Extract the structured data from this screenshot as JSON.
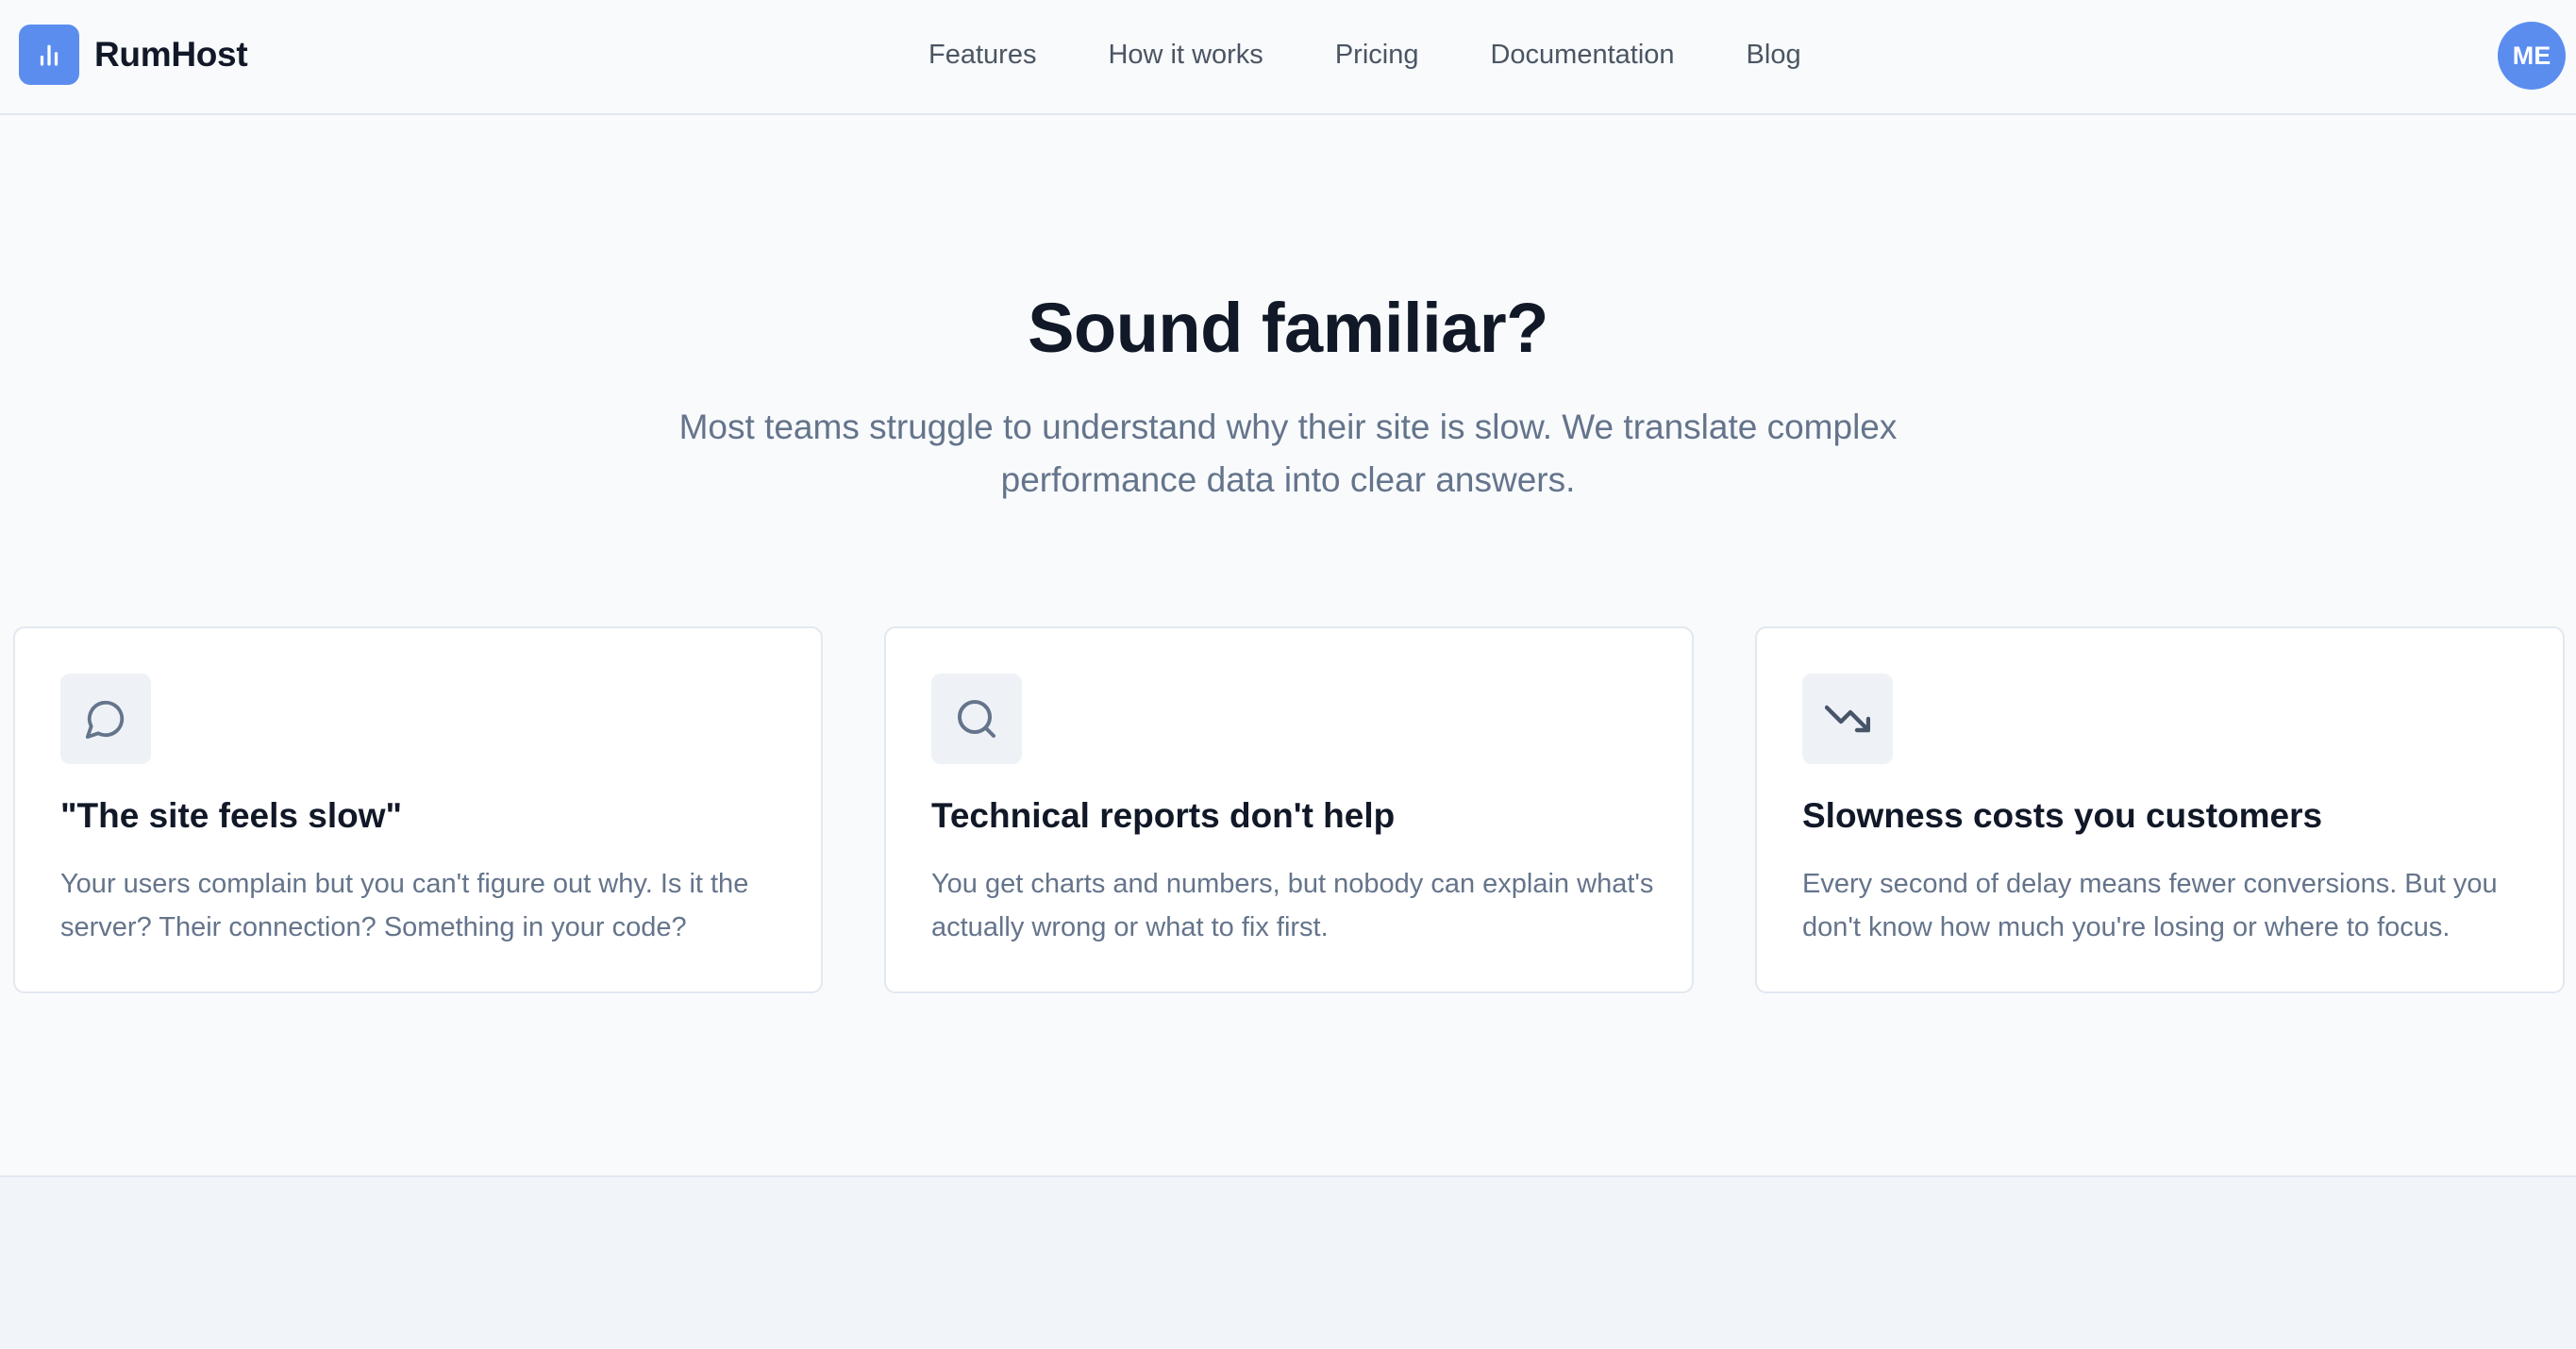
{
  "brand": {
    "name": "RumHost",
    "logo_icon": "bar-chart-icon",
    "accent_color": "#5b8def"
  },
  "nav": {
    "items": [
      {
        "label": "Features"
      },
      {
        "label": "How it works"
      },
      {
        "label": "Pricing"
      },
      {
        "label": "Documentation"
      },
      {
        "label": "Blog"
      }
    ]
  },
  "user": {
    "initials": "ME"
  },
  "hero": {
    "title": "Sound familiar?",
    "subtitle": "Most teams struggle to understand why their site is slow. We translate complex performance data into clear answers."
  },
  "cards": [
    {
      "icon": "speech-bubble-icon",
      "title": "\"The site feels slow\"",
      "text": "Your users complain but you can't figure out why. Is it the server? Their connection? Something in your code?"
    },
    {
      "icon": "search-icon",
      "title": "Technical reports don't help",
      "text": "You get charts and numbers, but nobody can explain what's actually wrong or what to fix first."
    },
    {
      "icon": "trending-down-icon",
      "title": "Slowness costs you customers",
      "text": "Every second of delay means fewer conversions. But you don't know how much you're losing or where to focus."
    }
  ]
}
